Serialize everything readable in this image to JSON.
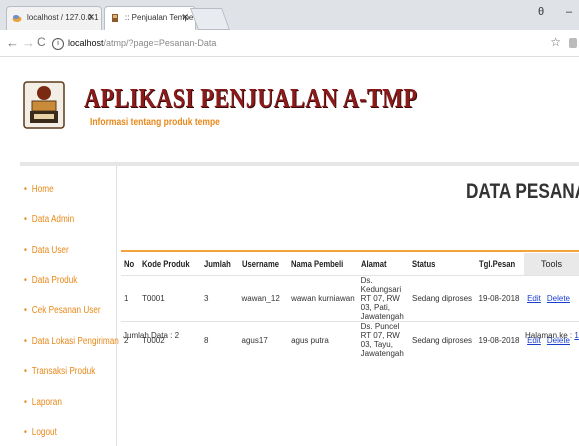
{
  "browser": {
    "tabs": [
      {
        "title": "localhost / 127.0.0.1 / p..."
      },
      {
        "title": ":: Penjualan Tempe ::"
      }
    ],
    "url_host": "localhost",
    "url_path": "/atmp/?page=Pesanan-Data"
  },
  "site": {
    "title": "APLIKASI PENJUALAN A-TMP",
    "subtitle": "Informasi tentang produk tempe"
  },
  "sidebar": {
    "items": [
      {
        "label": "Home"
      },
      {
        "label": "Data Admin"
      },
      {
        "label": "Data User"
      },
      {
        "label": "Data Produk"
      },
      {
        "label": "Cek Pesanan User"
      },
      {
        "label": "Data Lokasi Pengiriman"
      },
      {
        "label": "Transaksi Produk"
      },
      {
        "label": "Laporan"
      },
      {
        "label": "Logout"
      }
    ]
  },
  "main": {
    "heading": "DATA PESANAN",
    "columns": [
      "No",
      "Kode Produk",
      "Jumlah",
      "Username",
      "Nama Pembeli",
      "Alamat",
      "Status",
      "Tgl.Pesan",
      "Tools"
    ],
    "rows": [
      {
        "no": "1",
        "kode": "T0001",
        "jumlah": "3",
        "username": "wawan_12",
        "nama": "wawan kurniawan",
        "alamat": "Ds. Kedungsari RT 07, RW 03, Pati, Jawatengah",
        "status": "Sedang diproses",
        "tgl": "19-08-2018",
        "edit": "Edit",
        "delete": "Delete"
      },
      {
        "no": "2",
        "kode": "T0002",
        "jumlah": "8",
        "username": "agus17",
        "nama": "agus putra",
        "alamat": "Ds. Puncel RT 07, RW 03, Tayu, Jawatengah",
        "status": "Sedang diproses",
        "tgl": "19-08-2018",
        "edit": "Edit",
        "delete": "Delete"
      }
    ],
    "total_label": "Jumlah Data : 2",
    "page_label": "Halaman ke :",
    "page_number": "1"
  }
}
